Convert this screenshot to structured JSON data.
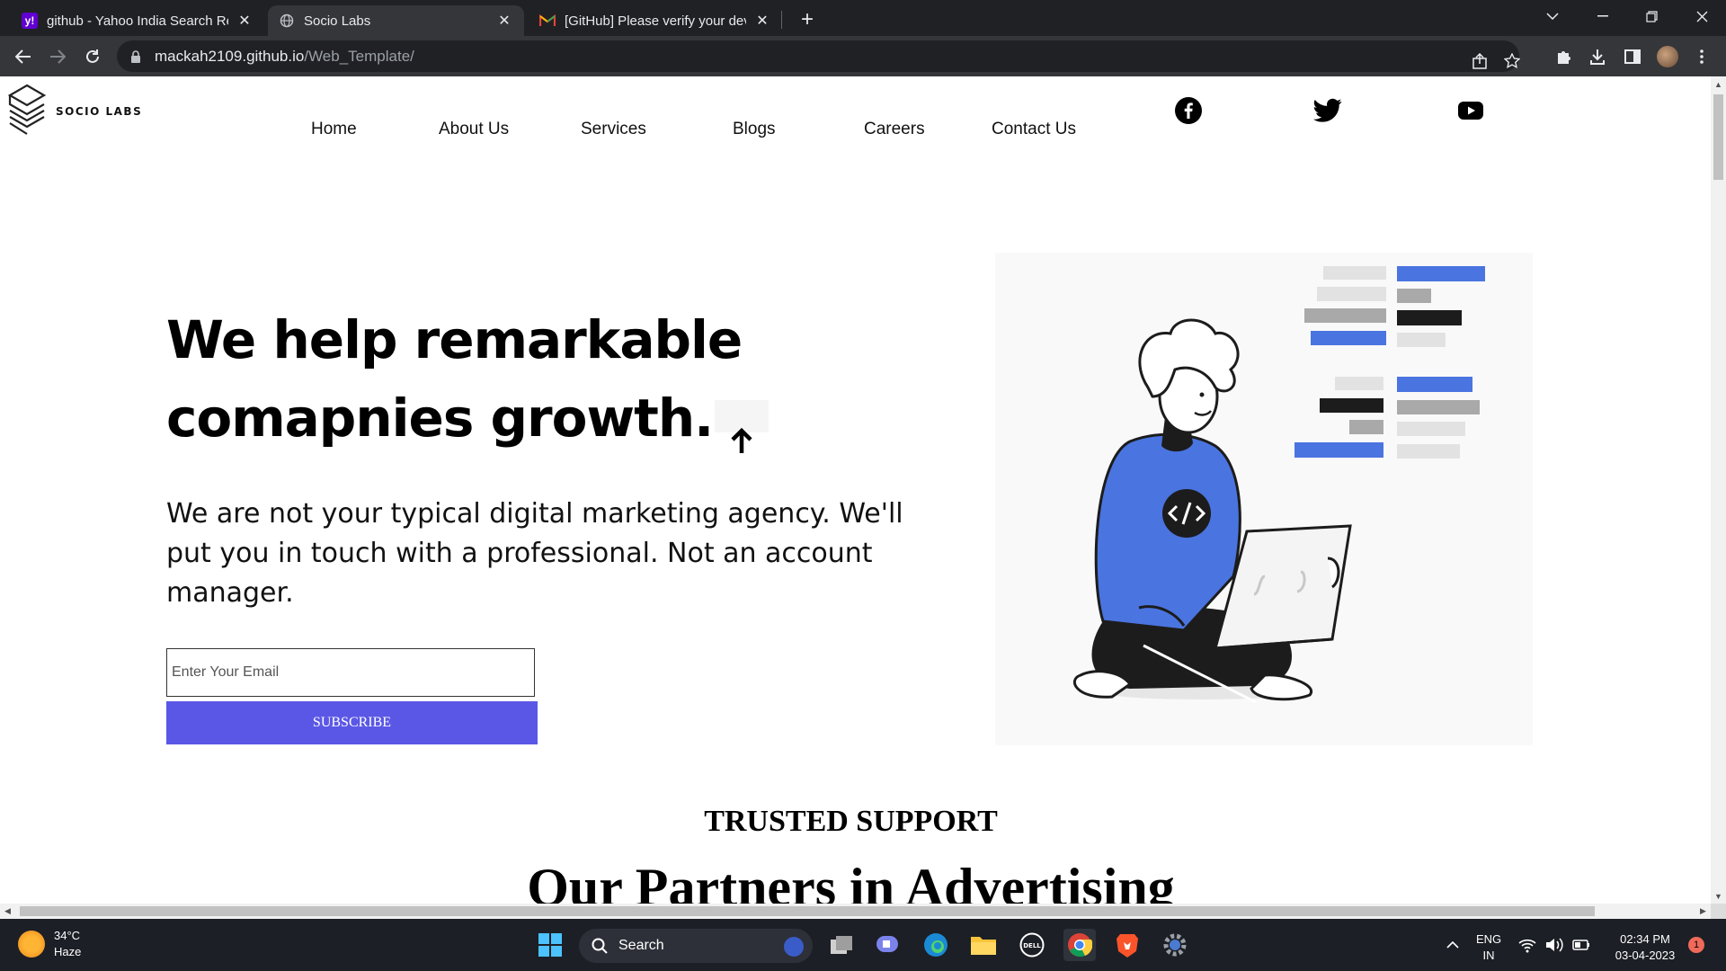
{
  "browser": {
    "tabs": [
      {
        "title": "github - Yahoo India Search Resu",
        "favicon": "yahoo-icon"
      },
      {
        "title": "Socio Labs",
        "favicon": "globe-icon"
      },
      {
        "title": "[GitHub] Please verify your devic",
        "favicon": "gmail-icon"
      }
    ],
    "url_host": "mackah2109.github.io",
    "url_path": "/Web_Template/"
  },
  "site": {
    "logo_text": "SOCIO LABS",
    "nav": [
      "Home",
      "About Us",
      "Services",
      "Blogs",
      "Careers",
      "Contact Us"
    ],
    "social": [
      "facebook-icon",
      "twitter-icon",
      "youtube-icon"
    ],
    "hero": {
      "title_line1": "We help remarkable",
      "title_line2": "comapnies growth.",
      "subtitle": "We are not your typical digital marketing agency. We'll put you in touch with a professional. Not an account manager.",
      "email_placeholder": "Enter Your Email",
      "subscribe_label": "SUBSCRIBE"
    },
    "trusted_label": "TRUSTED SUPPORT",
    "partners_heading": "Our Partners in Advertising"
  },
  "taskbar": {
    "temperature": "34°C",
    "weather": "Haze",
    "search_label": "Search",
    "lang_top": "ENG",
    "lang_bottom": "IN",
    "time": "02:34 PM",
    "date": "03-04-2023",
    "notification_count": "1"
  },
  "colors": {
    "accent": "#5b57e6",
    "illustration_blue": "#4a74e0"
  }
}
